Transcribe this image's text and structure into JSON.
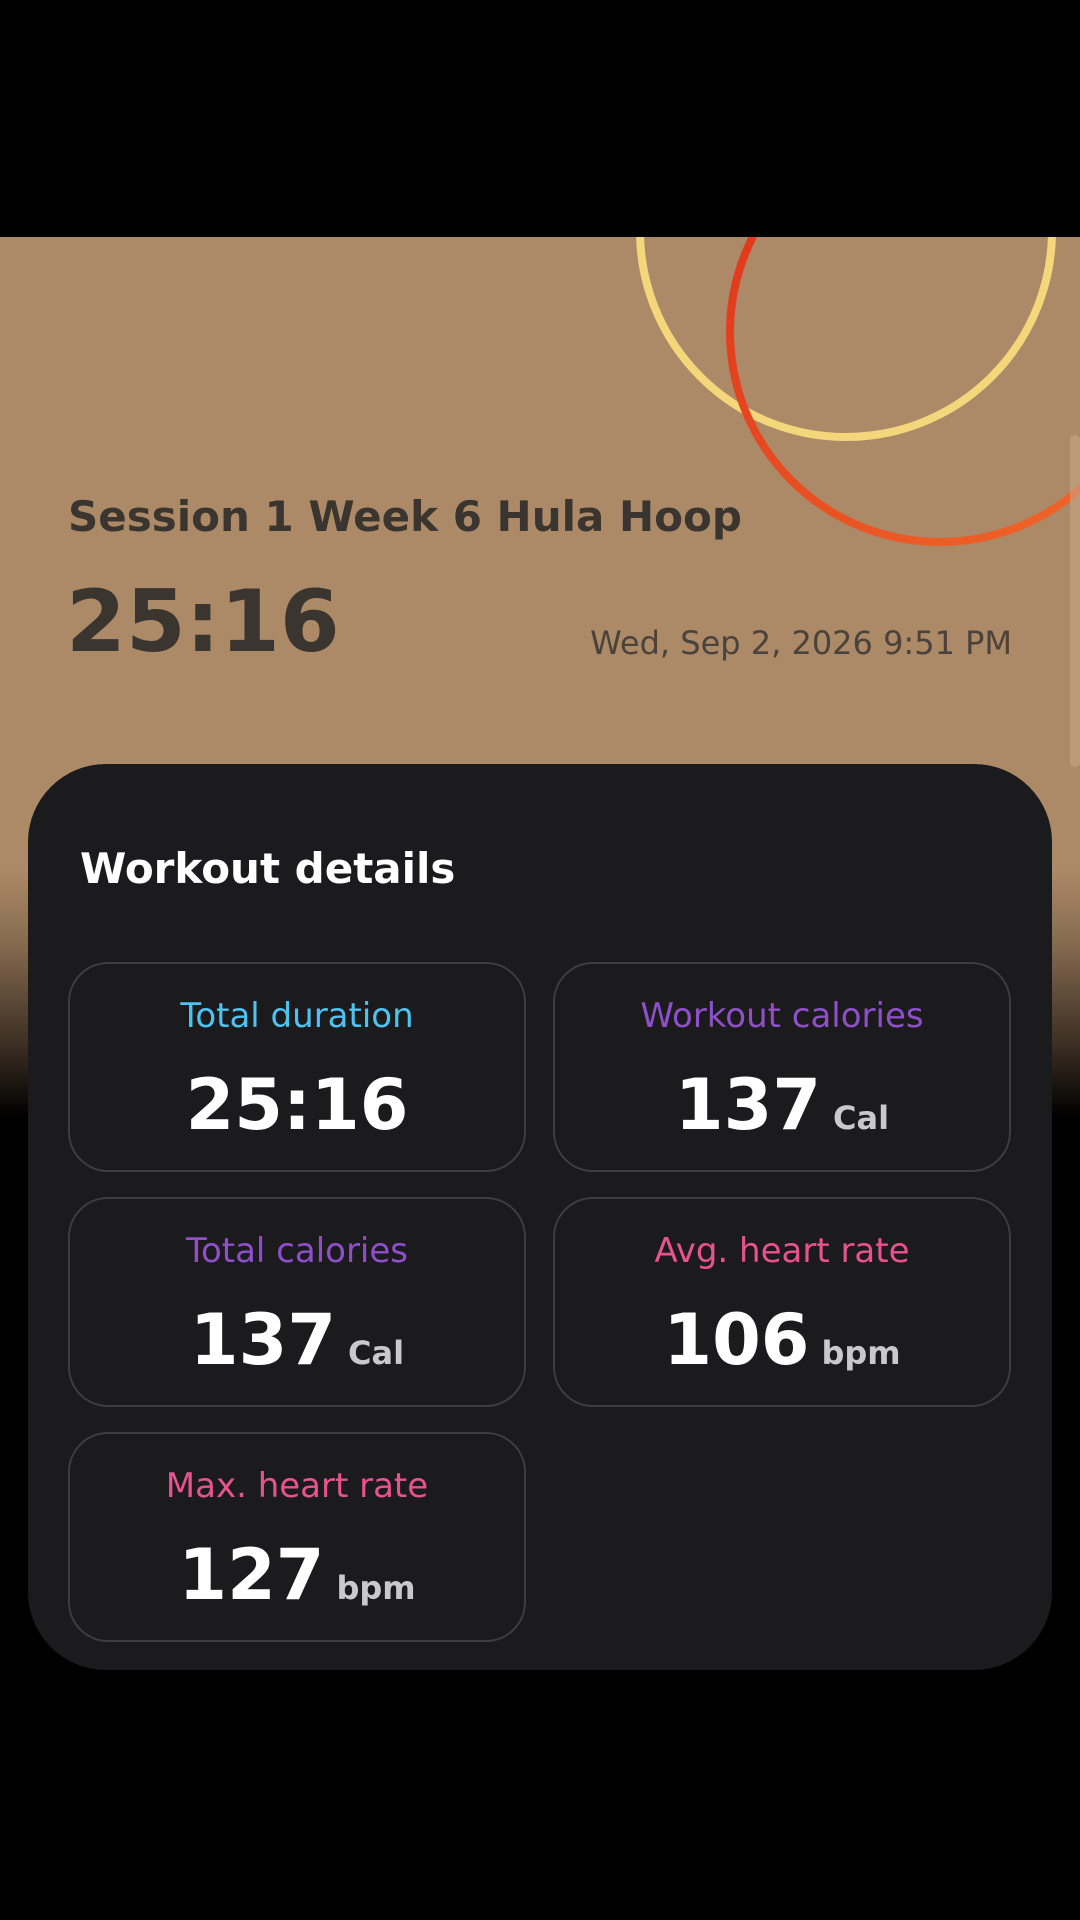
{
  "workout": {
    "title": "Session 1 Week 6 Hula Hoop",
    "duration": "25:16",
    "datetime": "Wed, Sep 2, 2026 9:51 PM"
  },
  "details": {
    "heading": "Workout details",
    "stats": [
      {
        "label": "Total duration",
        "value": "25:16",
        "unit": "",
        "color": "#4cc3f0"
      },
      {
        "label": "Workout calories",
        "value": "137",
        "unit": "Cal",
        "color": "#8e4fc9"
      },
      {
        "label": "Total calories",
        "value": "137",
        "unit": "Cal",
        "color": "#8e4fc9"
      },
      {
        "label": "Avg. heart rate",
        "value": "106",
        "unit": "bpm",
        "color": "#e8538f"
      },
      {
        "label": "Max. heart rate",
        "value": "127",
        "unit": "bpm",
        "color": "#e8538f"
      }
    ]
  },
  "colors": {
    "hero_background": "#ad8a67",
    "card_background": "#1b1b1d",
    "ring_yellow": "#f4d77a",
    "ring_red": "#e8401f"
  }
}
